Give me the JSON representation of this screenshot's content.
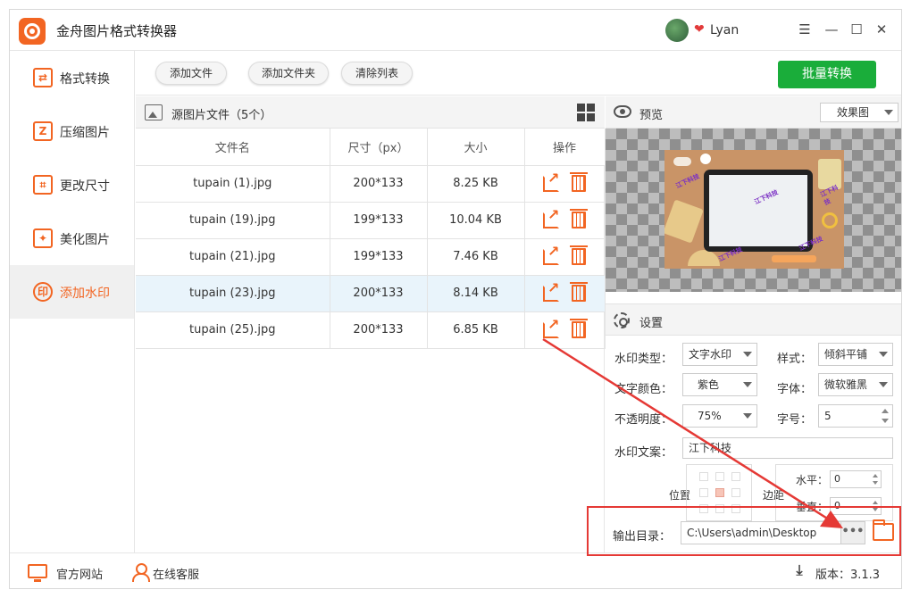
{
  "app": {
    "title": "金舟图片格式转换器",
    "user": "Lyan"
  },
  "sidebar": {
    "items": [
      {
        "label": "格式转换",
        "icon": "swap-icon"
      },
      {
        "label": "压缩图片",
        "icon": "compress-icon"
      },
      {
        "label": "更改尺寸",
        "icon": "crop-icon"
      },
      {
        "label": "美化图片",
        "icon": "beautify-icon"
      },
      {
        "label": "添加水印",
        "icon": "watermark-icon",
        "active": true
      }
    ]
  },
  "toolbar": {
    "add_file": "添加文件",
    "add_folder": "添加文件夹",
    "clear_list": "清除列表",
    "batch_convert": "批量转换"
  },
  "files": {
    "title": "源图片文件（5个）",
    "columns": [
      "文件名",
      "尺寸（px）",
      "大小",
      "操作"
    ],
    "rows": [
      {
        "name": "tupain (1).jpg",
        "size": "200*133",
        "bytes": "8.25 KB"
      },
      {
        "name": "tupain (19).jpg",
        "size": "199*133",
        "bytes": "10.04 KB"
      },
      {
        "name": "tupain (21).jpg",
        "size": "199*133",
        "bytes": "7.46 KB"
      },
      {
        "name": "tupain (23).jpg",
        "size": "200*133",
        "bytes": "8.14 KB",
        "selected": true
      },
      {
        "name": "tupain (25).jpg",
        "size": "200*133",
        "bytes": "6.85 KB"
      }
    ]
  },
  "preview": {
    "title": "预览",
    "mode": "效果图",
    "watermark_sample": "江下科技"
  },
  "settings": {
    "title": "设置",
    "watermark_type_label": "水印类型：",
    "watermark_type": "文字水印",
    "style_label": "样式：",
    "style": "倾斜平铺",
    "text_color_label": "文字颜色：",
    "text_color": "紫色",
    "font_label": "字体：",
    "font": "微软雅黑",
    "opacity_label": "不透明度：",
    "opacity": "75%",
    "font_size_label": "字号：",
    "font_size": "5",
    "text_label": "水印文案：",
    "text": "江下科技",
    "position_label": "位置",
    "margin_label": "边距",
    "horizontal_label": "水平：",
    "horizontal": "0",
    "vertical_label": "垂直：",
    "vertical": "0",
    "output_label": "输出目录：",
    "output_path": "C:\\Users\\admin\\Desktop",
    "browse": "•••"
  },
  "status": {
    "website": "官方网站",
    "service": "在线客服",
    "version": "版本：3.1.3"
  },
  "colors": {
    "accent": "#f26522",
    "primary_button": "#1aad3a",
    "highlight_red": "#e53935",
    "selected_row": "#e9f4fb"
  }
}
